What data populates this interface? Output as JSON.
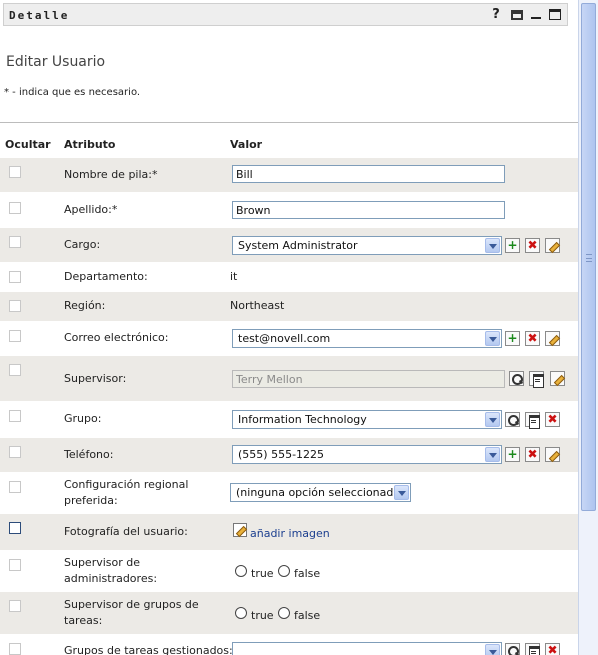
{
  "titlebar": {
    "title": "Detalle",
    "icons": [
      "help-icon",
      "print-icon",
      "minimize-icon",
      "maximize-icon"
    ],
    "help_glyph": "?"
  },
  "page": {
    "title": "Editar Usuario",
    "required_note": "* - indica que es necesario."
  },
  "columns": {
    "hide": "Ocultar",
    "attribute": "Atributo",
    "value": "Valor"
  },
  "fields": {
    "first_name": {
      "label": "Nombre de pila:*",
      "value": "Bill"
    },
    "last_name": {
      "label": "Apellido:*",
      "value": "Brown"
    },
    "title": {
      "label": "Cargo:",
      "value": "System Administrator"
    },
    "department": {
      "label": "Departamento:",
      "value": "it"
    },
    "region": {
      "label": "Región:",
      "value": "Northeast"
    },
    "email": {
      "label": "Correo electrónico:",
      "value": "test@novell.com"
    },
    "manager": {
      "label": "Supervisor:",
      "value": "Terry Mellon"
    },
    "group": {
      "label": "Grupo:",
      "value": "Information Technology"
    },
    "phone": {
      "label": "Teléfono:",
      "value": "(555) 555-1225"
    },
    "locale": {
      "label_line1": "Configuración regional",
      "label_line2": "preferida:",
      "value": "(ninguna opción seleccionada)"
    },
    "photo": {
      "label": "Fotografía del usuario:",
      "link": "añadir imagen"
    },
    "admin_manager": {
      "label_line1": "Supervisor de",
      "label_line2": "administradores:",
      "opt_true": "true",
      "opt_false": "false"
    },
    "task_group_manager": {
      "label_line1": "Supervisor de grupos de",
      "label_line2": "tareas:",
      "opt_true": "true",
      "opt_false": "false"
    },
    "managed_task_groups": {
      "label": "Grupos de tareas gestionados:",
      "value": ""
    }
  },
  "action_glyphs": {
    "add": "+",
    "delete": "✖"
  },
  "colors": {
    "row_shade": "#eceae6",
    "link": "#1c3f8f",
    "add_icon": "#1d8a1d",
    "delete_icon": "#cc1111"
  }
}
